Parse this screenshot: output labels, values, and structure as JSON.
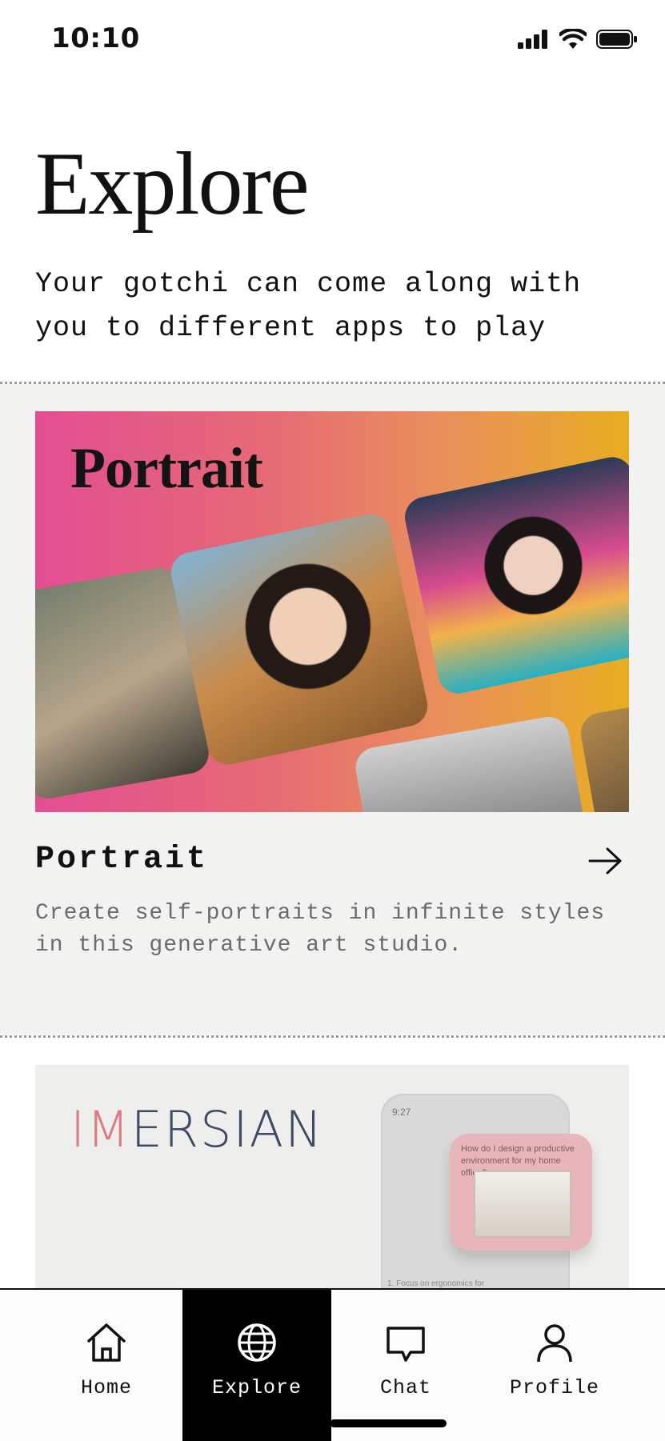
{
  "status_bar": {
    "time": "10:10"
  },
  "page": {
    "title": "Explore",
    "subtitle": "Your gotchi can come along with you to different apps to play"
  },
  "cards": [
    {
      "hero_title": "Portrait",
      "title": "Portrait",
      "description": "Create self-portraits in infinite styles in this generative art studio."
    },
    {
      "logo_first": "IM",
      "logo_rest": "ERSIAN",
      "phone_time": "9:27",
      "bubble_text": "How do I design a productive environment for my home office?",
      "pill_text": "1. Focus on ergonomics for"
    }
  ],
  "tabs": [
    {
      "label": "Home",
      "icon": "home-icon"
    },
    {
      "label": "Explore",
      "icon": "globe-icon",
      "active": true
    },
    {
      "label": "Chat",
      "icon": "chat-bubble-icon"
    },
    {
      "label": "Profile",
      "icon": "person-icon"
    }
  ],
  "colors": {
    "accent_pink": "#e34e93",
    "accent_orange": "#e8ad20",
    "active_tab_bg": "#000000"
  }
}
